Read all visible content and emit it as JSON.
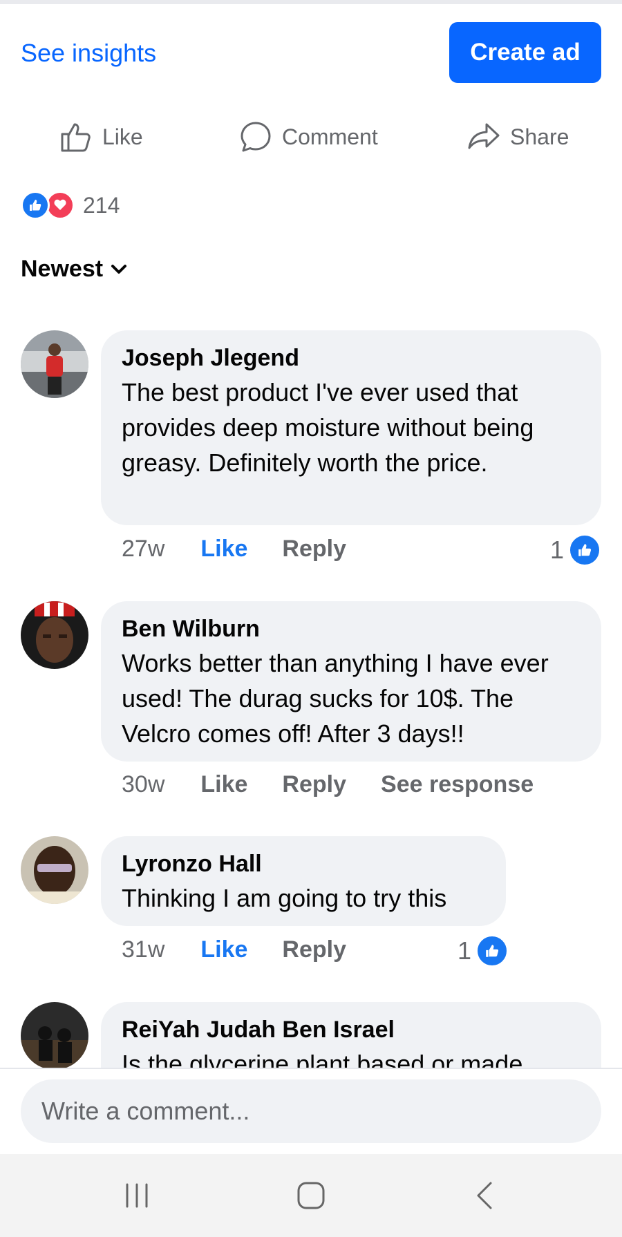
{
  "header": {
    "see_insights": "See insights",
    "create_ad": "Create ad"
  },
  "actions": {
    "like": "Like",
    "comment": "Comment",
    "share": "Share"
  },
  "reactions": {
    "count": "214"
  },
  "sort": {
    "label": "Newest"
  },
  "comments": [
    {
      "author": "Joseph Jlegend",
      "text": "The best product I've ever used that provides deep moisture without being greasy. Definitely worth the price.",
      "time": "27w",
      "like": "Like",
      "reply": "Reply",
      "like_count": "1",
      "liked": true
    },
    {
      "author": "Ben Wilburn",
      "text": "Works better than anything I have ever used! The durag sucks for 10$. The Velcro comes off! After 3 days!!",
      "time": "30w",
      "like": "Like",
      "reply": "Reply",
      "see_response": "See response"
    },
    {
      "author": "Lyronzo Hall",
      "text": "Thinking I am going to try this",
      "time": "31w",
      "like": "Like",
      "reply": "Reply",
      "like_count": "1",
      "liked": true
    },
    {
      "author": "ReiYah Judah Ben Israel",
      "text": "Is the glycerine plant based or made"
    }
  ],
  "composer": {
    "placeholder": "Write a comment..."
  },
  "colors": {
    "accent": "#0866ff",
    "like_blue": "#1877f2",
    "love_red": "#f33e58",
    "bubble_bg": "#f0f2f5",
    "muted": "#65676b"
  },
  "icons": [
    "thumbs-up-icon",
    "comment-icon",
    "share-icon",
    "chevron-down-icon",
    "heart-icon",
    "recent-apps-icon",
    "home-icon",
    "back-icon"
  ]
}
